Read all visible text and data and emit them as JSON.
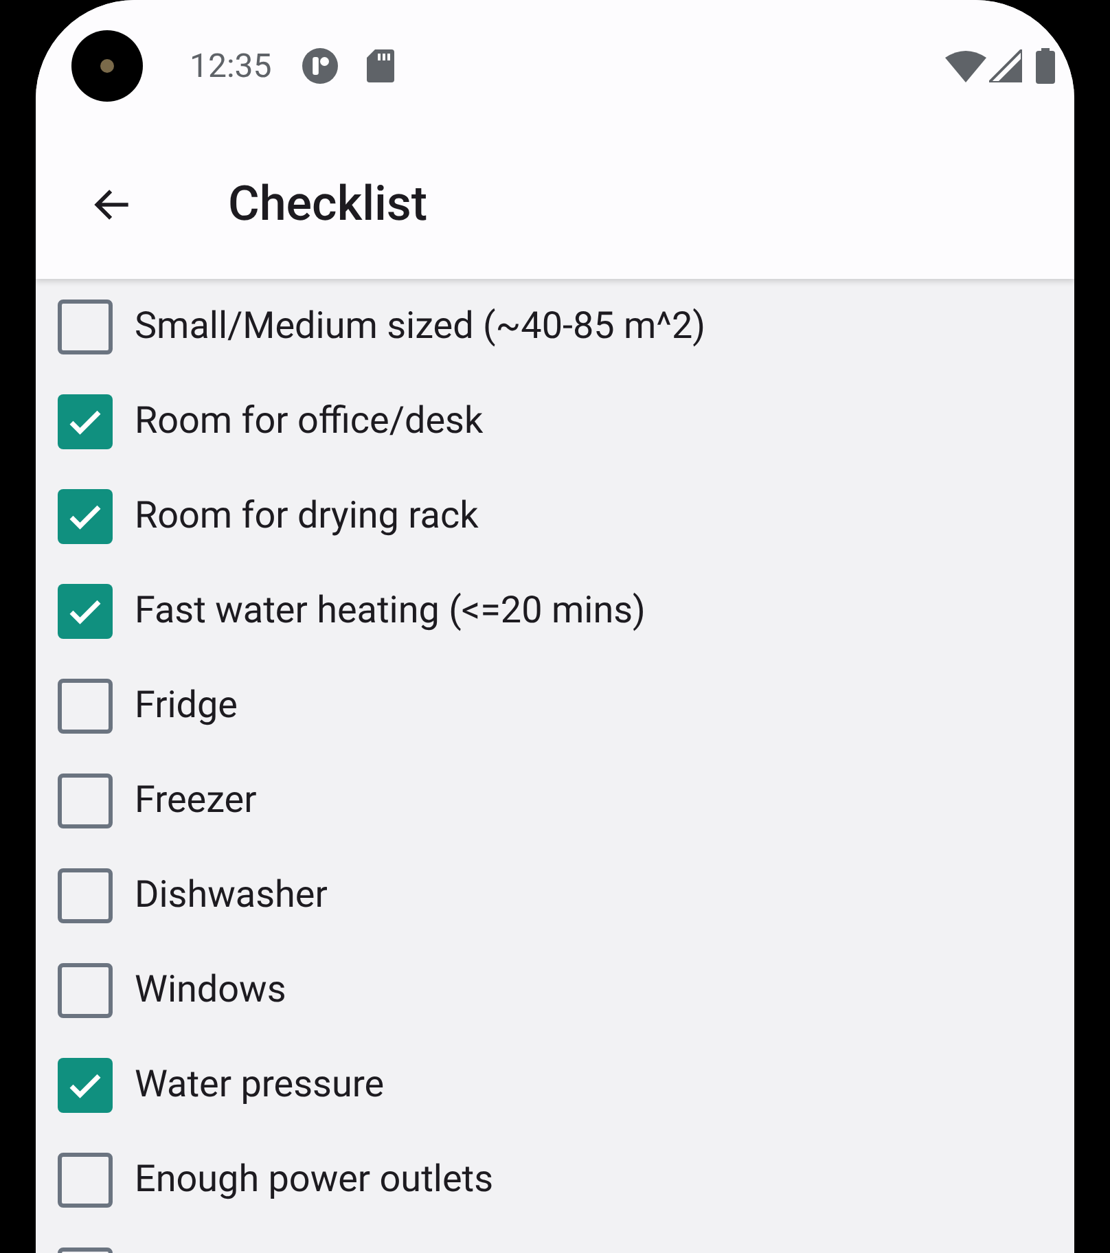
{
  "status_bar": {
    "time": "12:35"
  },
  "app_bar": {
    "title": "Checklist"
  },
  "items": [
    {
      "label": "Small/Medium sized (~40-85 m^2)",
      "checked": false
    },
    {
      "label": "Room for office/desk",
      "checked": true
    },
    {
      "label": "Room for drying rack",
      "checked": true
    },
    {
      "label": "Fast water heating (<=20 mins)",
      "checked": true
    },
    {
      "label": "Fridge",
      "checked": false
    },
    {
      "label": "Freezer",
      "checked": false
    },
    {
      "label": "Dishwasher",
      "checked": false
    },
    {
      "label": "Windows",
      "checked": false
    },
    {
      "label": "Water pressure",
      "checked": true
    },
    {
      "label": "Enough power outlets",
      "checked": false
    },
    {
      "checked": false
    }
  ]
}
